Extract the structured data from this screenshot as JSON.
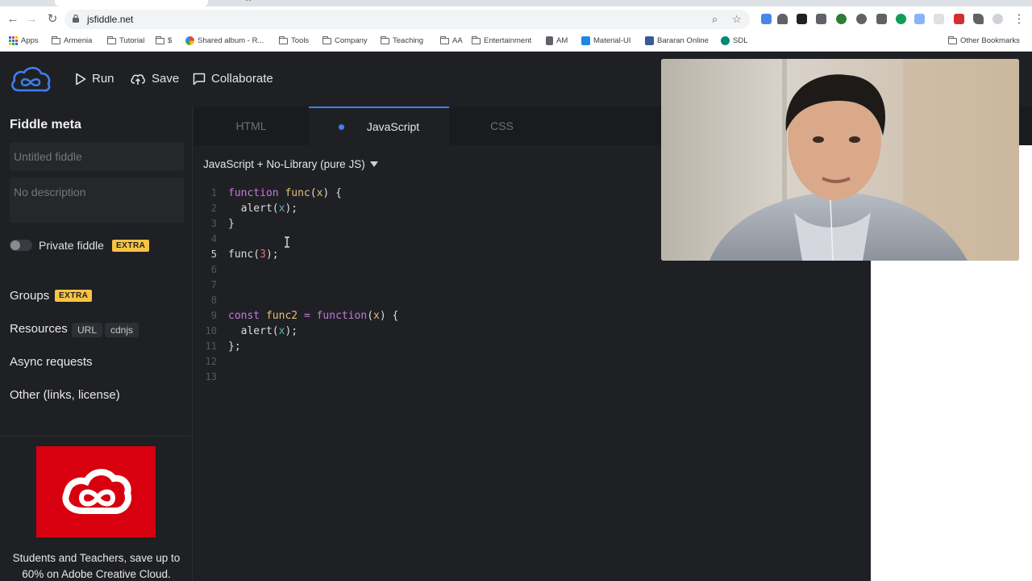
{
  "browser": {
    "url": "jsfiddle.net",
    "bookmarks": [
      {
        "label": "Apps",
        "icon": "apps-grid-icon"
      },
      {
        "label": "Armenia",
        "icon": "folder-icon"
      },
      {
        "label": "Tutorial",
        "icon": "folder-icon"
      },
      {
        "label": "$",
        "icon": "folder-icon"
      },
      {
        "label": "Shared album - R...",
        "icon": "photos-icon"
      },
      {
        "label": "Tools",
        "icon": "folder-icon"
      },
      {
        "label": "Company",
        "icon": "folder-icon"
      },
      {
        "label": "Teaching",
        "icon": "folder-icon"
      },
      {
        "label": "AA",
        "icon": "folder-icon"
      },
      {
        "label": "Entertainment",
        "icon": "folder-icon"
      },
      {
        "label": "AM",
        "icon": "am-icon"
      },
      {
        "label": "Material-UI",
        "icon": "material-ui-icon"
      },
      {
        "label": "Bararan Online",
        "icon": "bararan-icon"
      },
      {
        "label": "SDL",
        "icon": "sdl-icon"
      }
    ],
    "other_bookmarks": "Other Bookmarks"
  },
  "header": {
    "run": "Run",
    "save": "Save",
    "collaborate": "Collaborate"
  },
  "sidebar": {
    "title": "Fiddle meta",
    "title_placeholder": "Untitled fiddle",
    "description_placeholder": "No description",
    "private_label": "Private fiddle",
    "extra_badge": "EXTRA",
    "groups": "Groups",
    "resources": "Resources",
    "url_pill": "URL",
    "cdnjs_pill": "cdnjs",
    "async": "Async requests",
    "other": "Other (links, license)",
    "ad_text": "Students and Teachers, save up to 60% on Adobe Creative Cloud."
  },
  "editor": {
    "tabs": [
      "HTML",
      "JavaScript",
      "CSS"
    ],
    "active_tab": "JavaScript",
    "language": "JavaScript + No-Library (pure JS)",
    "current_line": "5",
    "line_numbers": [
      "1",
      "2",
      "3",
      "4",
      "5",
      "6",
      "7",
      "8",
      "9",
      "10",
      "11",
      "12",
      "13"
    ]
  },
  "colors": {
    "accent": "#3f7ff0",
    "extra_badge": "#f7c342",
    "adobe_red": "#d8000e",
    "background": "#1f2024"
  }
}
